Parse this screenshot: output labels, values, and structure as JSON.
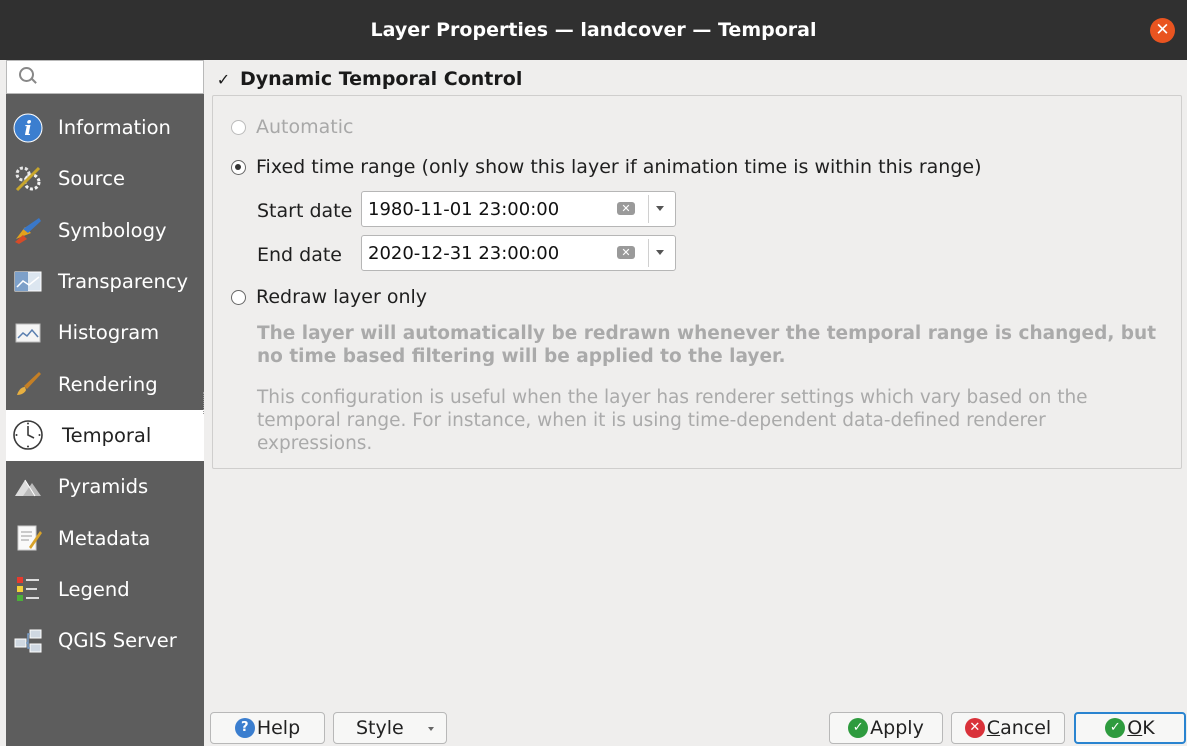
{
  "window": {
    "title": "Layer Properties — landcover — Temporal",
    "close_glyph": "✕"
  },
  "sidebar": {
    "search_placeholder": "",
    "items": [
      {
        "label": "Information",
        "icon": "information-icon"
      },
      {
        "label": "Source",
        "icon": "source-icon"
      },
      {
        "label": "Symbology",
        "icon": "symbology-icon"
      },
      {
        "label": "Transparency",
        "icon": "transparency-icon"
      },
      {
        "label": "Histogram",
        "icon": "histogram-icon"
      },
      {
        "label": "Rendering",
        "icon": "rendering-icon"
      },
      {
        "label": "Temporal",
        "icon": "clock-icon",
        "active": true
      },
      {
        "label": "Pyramids",
        "icon": "pyramids-icon"
      },
      {
        "label": "Metadata",
        "icon": "metadata-icon"
      },
      {
        "label": "Legend",
        "icon": "legend-icon"
      },
      {
        "label": "QGIS Server",
        "icon": "qgis-server-icon"
      }
    ]
  },
  "temporal": {
    "dynamic_control_label": "Dynamic Temporal Control",
    "dynamic_control_checked": true,
    "check_glyph": "✓",
    "automatic_label": "Automatic",
    "fixed_label": "Fixed time range (only show this layer if animation time is within this range)",
    "start_label": "Start date",
    "start_value": "1980-11-01 23:00:00",
    "end_label": "End date",
    "end_value": "2020-12-31 23:00:00",
    "clear_glyph": "✕",
    "redraw_label": "Redraw layer only",
    "redraw_note_bold": "The layer will automatically be redrawn whenever the temporal range is changed, but no time based filtering will be applied to the layer.",
    "redraw_note": "This configuration is useful when the layer has renderer settings which vary based on the temporal range. For instance, when it is using time-dependent data-defined renderer expressions.",
    "selected_mode": "fixed"
  },
  "buttons": {
    "help": "Help",
    "style": "Style",
    "apply": "Apply",
    "cancel_first": "C",
    "cancel_rest": "ancel",
    "ok_first": "O",
    "ok_rest": "K",
    "help_glyph": "?",
    "apply_glyph": "✓",
    "cancel_glyph": "✕",
    "ok_glyph": "✓"
  },
  "colors": {
    "titlebar": "#303030",
    "sidebar": "#5d5d5d",
    "close": "#e95420",
    "ok_border": "#2a84d0"
  }
}
